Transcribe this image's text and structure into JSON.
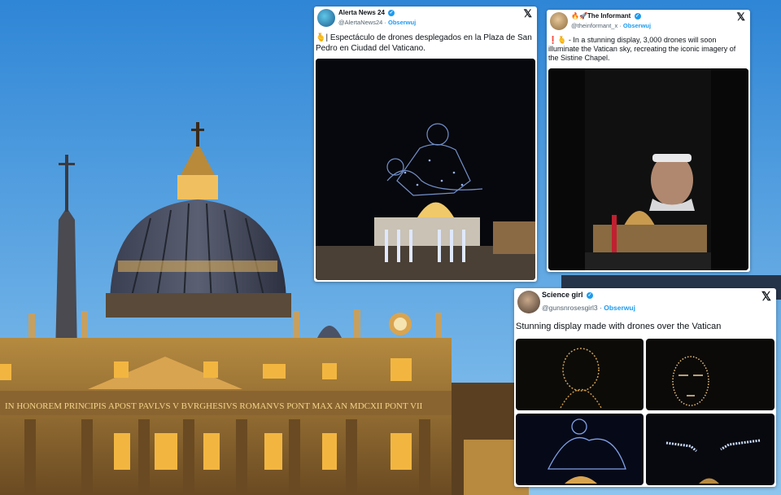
{
  "tweets": [
    {
      "author": "Alerta News 24",
      "handle": "@AlertaNews24",
      "follow": "Obserwuj",
      "text": "🫰| Espectáculo de drones desplegados en la Plaza de San Pedro en Ciudad del Vaticano."
    },
    {
      "author": "🔥🚀The Informant",
      "handle": "@theinformant_x",
      "follow": "Obserwuj",
      "text": "❗🫰 - In a stunning display, 3,000 drones will soon illuminate the Vatican sky, recreating the iconic imagery of the Sistine Chapel."
    },
    {
      "author": "Science girl",
      "handle": "@gunsnrosesgirl3",
      "follow": "Obserwuj",
      "text": "Stunning display made with drones over the Vatican"
    }
  ],
  "facade_inscription": "IN HONOREM PRINCIPIS APOST PAVLVS V BVRGHESIVS ROMANVS PONT MAX AN MDCXII PONT VII",
  "icons": [
    "x-logo-icon",
    "verified-badge-icon"
  ],
  "colors": {
    "sky": "#5aa3df",
    "accent": "#1d9bf0",
    "text": "#0f1419",
    "muted": "#536471"
  }
}
